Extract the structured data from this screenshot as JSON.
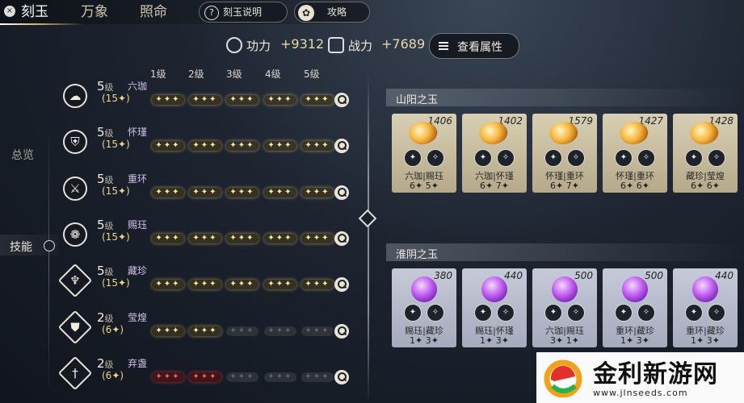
{
  "tabs": [
    {
      "label": "刻玉",
      "active": true
    },
    {
      "label": "万象",
      "active": false
    },
    {
      "label": "照命",
      "active": false
    }
  ],
  "help_button": {
    "icon": "?",
    "label": "刻玉说明"
  },
  "guide_button": {
    "label": "攻略"
  },
  "stats": {
    "power_label": "功力",
    "power_value": "+9312",
    "combat_label": "战力",
    "combat_value": "+7689"
  },
  "attr_button": "查看属性",
  "levels": [
    "1级",
    "2级",
    "3级",
    "4级",
    "5级"
  ],
  "side": {
    "overview": "总览",
    "skills": "技能"
  },
  "skills": [
    {
      "icon": "cloud-icon",
      "glyph": "☁",
      "shape": "circle",
      "level": "5",
      "unit": "级",
      "name": "六珈",
      "count": "(15✦)",
      "pips": [
        "on",
        "on",
        "on",
        "on",
        "on"
      ]
    },
    {
      "icon": "shield-icon",
      "glyph": "⛨",
      "shape": "circle",
      "level": "5",
      "unit": "级",
      "name": "怀瑾",
      "count": "(15✦)",
      "pips": [
        "on",
        "on",
        "on",
        "on",
        "on"
      ]
    },
    {
      "icon": "sword-icon",
      "glyph": "⚔",
      "shape": "circle",
      "level": "5",
      "unit": "级",
      "name": "重环",
      "count": "(15✦)",
      "pips": [
        "on",
        "on",
        "on",
        "on",
        "on"
      ]
    },
    {
      "icon": "lotus-icon",
      "glyph": "❁",
      "shape": "circle",
      "level": "5",
      "unit": "级",
      "name": "赐珏",
      "count": "(15✦)",
      "pips": [
        "on",
        "on",
        "on",
        "on",
        "on"
      ]
    },
    {
      "icon": "phoenix-icon",
      "glyph": "♆",
      "shape": "diamond",
      "level": "5",
      "unit": "级",
      "name": "藏珍",
      "count": "(15✦)",
      "pips": [
        "on",
        "on",
        "on",
        "on",
        "on"
      ]
    },
    {
      "icon": "crest-icon",
      "glyph": "⛊",
      "shape": "diamond",
      "level": "2",
      "unit": "级",
      "name": "莹煌",
      "count": "(6✦)",
      "pips": [
        "on",
        "on",
        "off",
        "off",
        "off"
      ]
    },
    {
      "icon": "blade-icon",
      "glyph": "†",
      "shape": "diamond",
      "level": "2",
      "unit": "级",
      "name": "弃盏",
      "count": "(6✦)",
      "pips": [
        "red",
        "red",
        "off",
        "off",
        "off"
      ]
    }
  ],
  "pip_text": "✦✦✦",
  "yang_panel": {
    "title": "山阳之玉",
    "cards": [
      {
        "value": "1406",
        "names": "六珈|赐珏",
        "nums": "6✦ 5✦"
      },
      {
        "value": "1402",
        "names": "六珈|怀瑾",
        "nums": "6✦ 7✦"
      },
      {
        "value": "1579",
        "names": "怀瑾|重环",
        "nums": "6✦ 7✦"
      },
      {
        "value": "1427",
        "names": "怀瑾|重环",
        "nums": "6✦ 6✦"
      },
      {
        "value": "1428",
        "names": "藏珍|莹煌",
        "nums": "6✦ 6✦"
      }
    ]
  },
  "yin_panel": {
    "title": "淮阴之玉",
    "cards": [
      {
        "value": "380",
        "names": "赐珏|藏珍",
        "nums": "1✦ 3✦"
      },
      {
        "value": "440",
        "names": "赐珏|怀瑾",
        "nums": "1✦ 3✦"
      },
      {
        "value": "500",
        "names": "六珈|赐珏",
        "nums": "3✦ 1✦"
      },
      {
        "value": "500",
        "names": "重环|藏珍",
        "nums": "1✦ 3✦"
      },
      {
        "value": "440",
        "names": "重环|藏珍",
        "nums": "1✦ 3✦"
      }
    ]
  },
  "watermark": {
    "title": "金利新游网",
    "url": "www.jlnseeds.com"
  }
}
